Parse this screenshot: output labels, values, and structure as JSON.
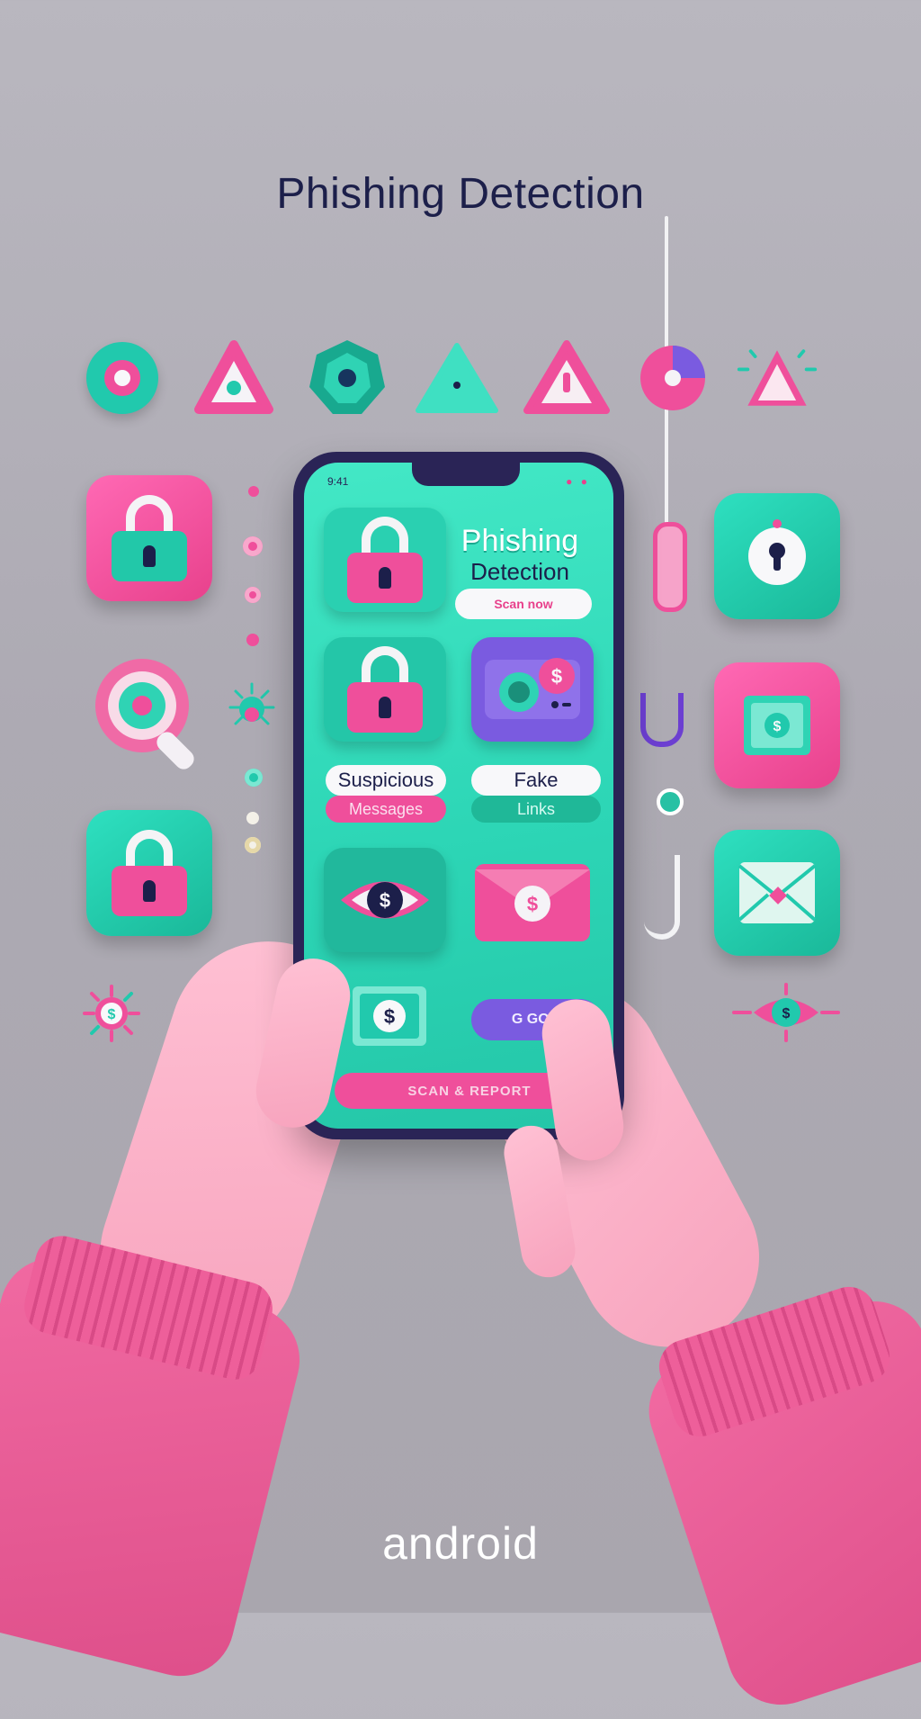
{
  "header": {
    "title": "Phishing Detection"
  },
  "phone": {
    "status_time": "9:41",
    "status_icons": "● ●",
    "app_title": "Phishing",
    "app_subtitle": "Detection",
    "scan_pill": "Scan now",
    "labels": {
      "suspicious_top": "Suspicious",
      "suspicious_bottom": "Messages",
      "fake_top": "Fake",
      "fake_bottom": "Links"
    },
    "dollar_glyph": "$",
    "pill_button_text": "G  GOG",
    "action_bar": "SCAN & REPORT"
  },
  "footer": {
    "brand": "android"
  },
  "colors": {
    "teal": "#2dd6b6",
    "pink": "#ef4f9b",
    "navy": "#1c1f4a",
    "purple": "#7a5be0",
    "background": "#b1aeb7"
  },
  "icons": {
    "top_row": [
      "target-icon",
      "alert-triangle-icon",
      "gem-icon",
      "triangle-icon",
      "warning-icon",
      "pie-icon",
      "warning-sparkle-icon"
    ],
    "left_column": [
      "padlock-icon",
      "magnifier-icon",
      "padlock-icon",
      "dollar-virus-icon"
    ],
    "right_column": [
      "keyhole-icon",
      "cash-icon",
      "envelope-icon",
      "dollar-eye-icon"
    ]
  }
}
